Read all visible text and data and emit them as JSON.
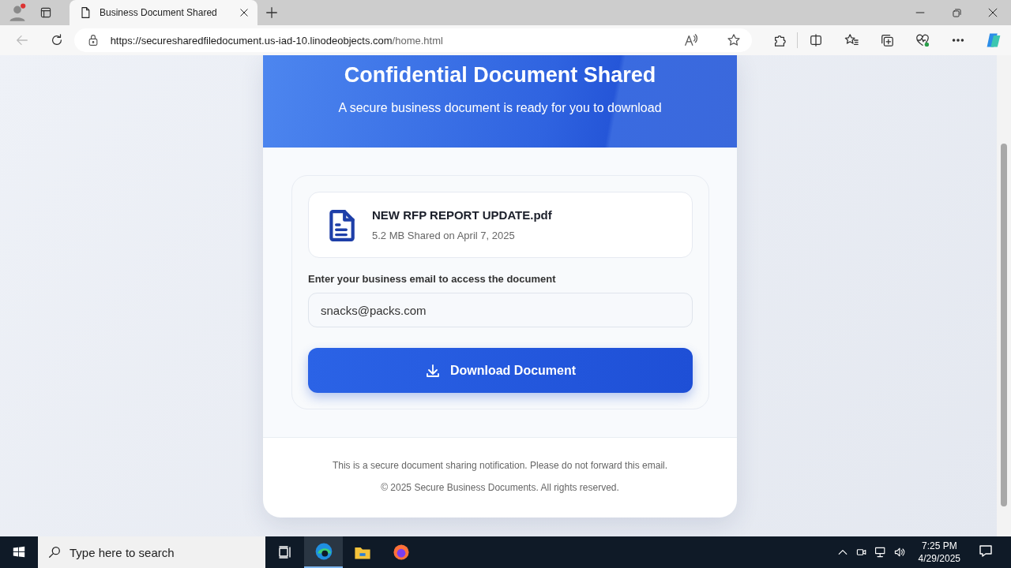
{
  "browser": {
    "tab": {
      "title": "Business Document Shared",
      "selected": true
    },
    "url": {
      "host": "https://securesharedfiledocument.us-iad-10.linodeobjects.com",
      "path": "/home.html"
    }
  },
  "page": {
    "header": {
      "title": "Confidential Document Shared",
      "subtitle": "A secure business document is ready for you to download"
    },
    "file": {
      "name": "NEW RFP REPORT UPDATE.pdf",
      "meta": "5.2 MB Shared on April 7, 2025"
    },
    "email": {
      "label": "Enter your business email to access the document",
      "value": "snacks@packs.com"
    },
    "download_button": "Download Document",
    "footer": [
      "This is a secure document sharing notification. Please do not forward this email.",
      "© 2025 Secure Business Documents. All rights reserved."
    ]
  },
  "taskbar": {
    "search": {
      "placeholder": "Type here to search"
    },
    "time": "7:25 PM",
    "date": "4/29/2025"
  }
}
